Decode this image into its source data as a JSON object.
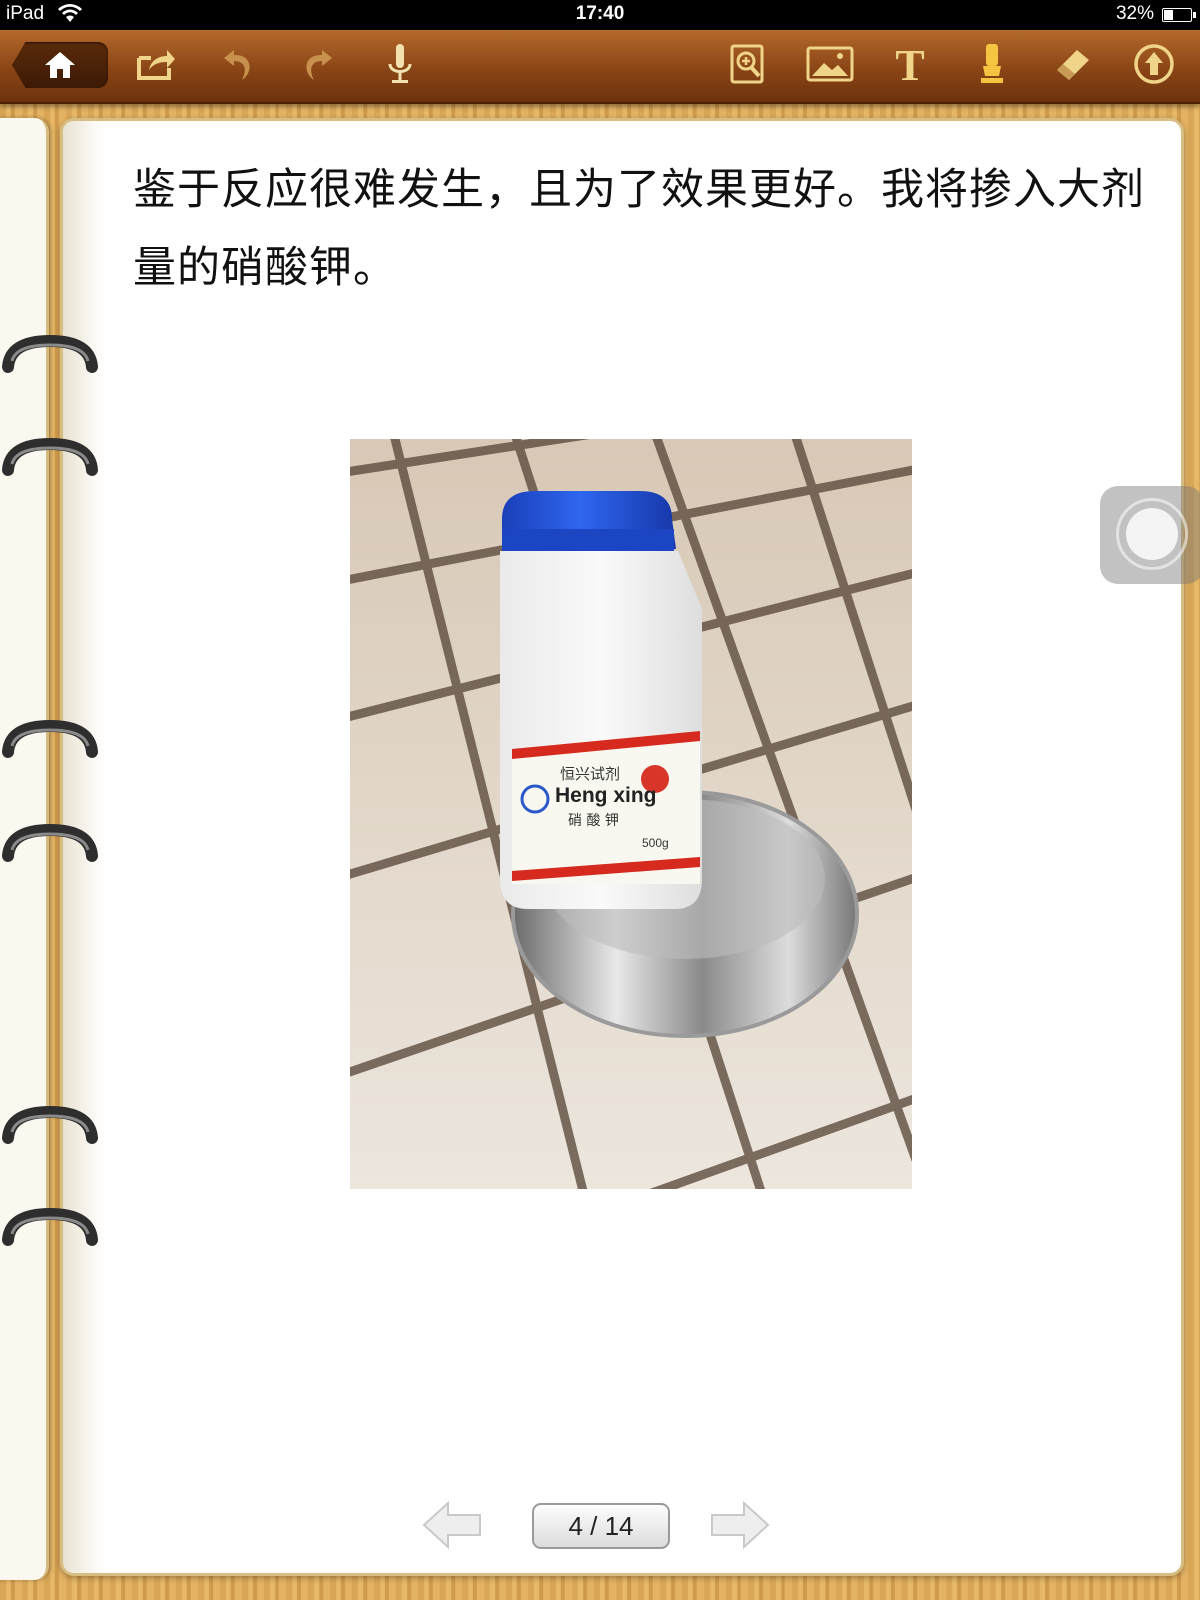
{
  "status_bar": {
    "device": "iPad",
    "time": "17:40",
    "battery_percent_label": "32%",
    "battery_level": 0.32
  },
  "toolbar": {
    "left_icons": [
      "home-icon",
      "share-icon",
      "undo-icon",
      "redo-icon",
      "microphone-icon"
    ],
    "right_icons": [
      "zoom-page-icon",
      "image-icon",
      "text-icon",
      "highlighter-icon",
      "eraser-icon",
      "upload-icon"
    ],
    "text_tool_label": "T"
  },
  "page": {
    "paragraph": "鉴于反应很难发生，且为了效果更好。我将掺入大剂量的硝酸钾。",
    "photo": {
      "label_brand_cn": "恒兴试剂",
      "label_brand": "Heng xing",
      "label_name": "硝 酸 钾",
      "label_weight": "500g"
    }
  },
  "pager": {
    "label": "4 / 14",
    "current": 4,
    "total": 14
  },
  "colors": {
    "toolbar": "#8a4516",
    "wood": "#d9a556",
    "page_border": "#d7bd82",
    "cap_blue": "#1f4fd6"
  }
}
